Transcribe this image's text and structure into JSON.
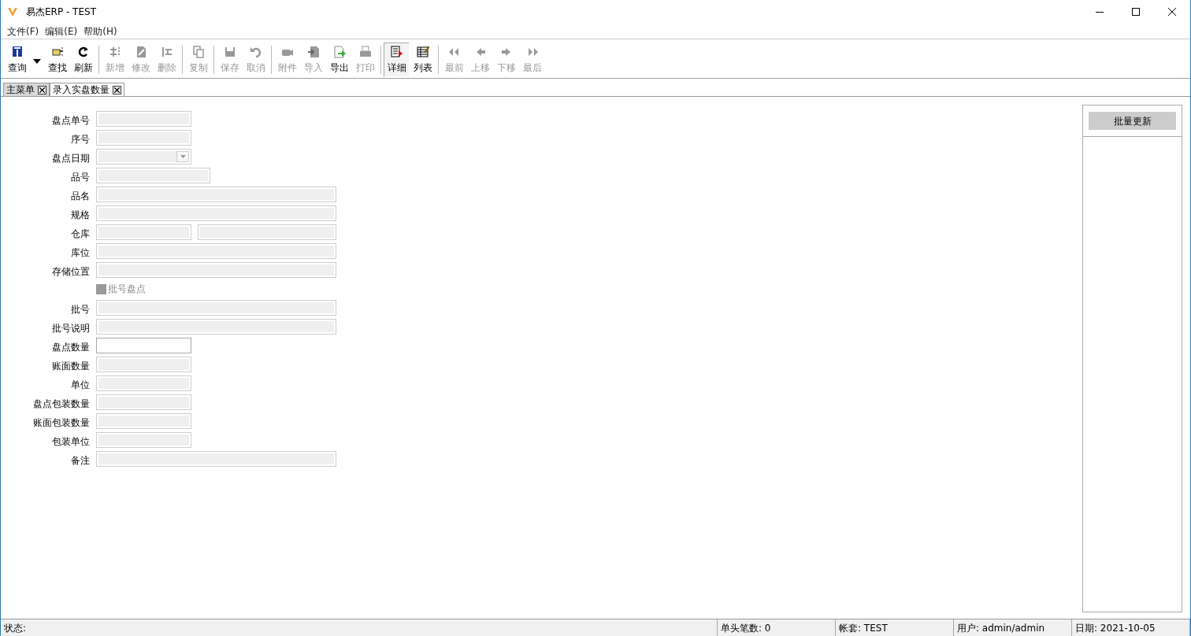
{
  "window": {
    "title": "易杰ERP - TEST"
  },
  "menu": [
    {
      "label": "文件(F)"
    },
    {
      "label": "编辑(E)"
    },
    {
      "label": "帮助(H)"
    }
  ],
  "toolbar": [
    {
      "kind": "button",
      "label": "查询",
      "disabled": false,
      "selected": false,
      "dropdown": true
    },
    {
      "kind": "button",
      "label": "查找",
      "disabled": false,
      "selected": false
    },
    {
      "kind": "button",
      "label": "刷新",
      "disabled": false,
      "selected": false
    },
    {
      "kind": "separator"
    },
    {
      "kind": "button",
      "label": "新增",
      "disabled": true,
      "selected": false
    },
    {
      "kind": "button",
      "label": "修改",
      "disabled": true,
      "selected": false
    },
    {
      "kind": "button",
      "label": "删除",
      "disabled": true,
      "selected": false
    },
    {
      "kind": "separator"
    },
    {
      "kind": "button",
      "label": "复制",
      "disabled": true,
      "selected": false
    },
    {
      "kind": "separator"
    },
    {
      "kind": "button",
      "label": "保存",
      "disabled": true,
      "selected": false
    },
    {
      "kind": "button",
      "label": "取消",
      "disabled": true,
      "selected": false
    },
    {
      "kind": "separator"
    },
    {
      "kind": "button",
      "label": "附件",
      "disabled": true,
      "selected": false
    },
    {
      "kind": "button",
      "label": "导入",
      "disabled": true,
      "selected": false
    },
    {
      "kind": "button",
      "label": "导出",
      "disabled": false,
      "selected": false
    },
    {
      "kind": "button",
      "label": "打印",
      "disabled": true,
      "selected": false
    },
    {
      "kind": "separator"
    },
    {
      "kind": "button",
      "label": "详细",
      "disabled": false,
      "selected": true
    },
    {
      "kind": "button",
      "label": "列表",
      "disabled": false,
      "selected": false
    },
    {
      "kind": "separator"
    },
    {
      "kind": "button",
      "label": "最前",
      "disabled": true,
      "selected": false
    },
    {
      "kind": "button",
      "label": "上移",
      "disabled": true,
      "selected": false
    },
    {
      "kind": "button",
      "label": "下移",
      "disabled": true,
      "selected": false
    },
    {
      "kind": "button",
      "label": "最后",
      "disabled": true,
      "selected": false
    }
  ],
  "tabs": [
    {
      "label": "主菜单",
      "selected": false
    },
    {
      "label": "录入实盘数量",
      "selected": true
    }
  ],
  "form": [
    {
      "kind": "short",
      "label": "盘点单号",
      "editable": false
    },
    {
      "kind": "short",
      "label": "序号",
      "editable": false
    },
    {
      "kind": "date",
      "label": "盘点日期",
      "editable": false
    },
    {
      "kind": "medium",
      "label": "品号",
      "editable": false
    },
    {
      "kind": "long",
      "label": "品名",
      "editable": false
    },
    {
      "kind": "long",
      "label": "规格",
      "editable": false
    },
    {
      "kind": "pair",
      "label": "仓库",
      "editable": false
    },
    {
      "kind": "long",
      "label": "库位",
      "editable": false
    },
    {
      "kind": "long",
      "label": "存储位置",
      "editable": false
    },
    {
      "kind": "checkbox",
      "label": "批号盘点",
      "checked": false,
      "disabled": true
    },
    {
      "kind": "long",
      "label": "批号",
      "editable": false
    },
    {
      "kind": "long",
      "label": "批号说明",
      "editable": false
    },
    {
      "kind": "short",
      "label": "盘点数量",
      "editable": true
    },
    {
      "kind": "short",
      "label": "账面数量",
      "editable": false
    },
    {
      "kind": "short",
      "label": "单位",
      "editable": false
    },
    {
      "kind": "short",
      "label": "盘点包装数量",
      "editable": false
    },
    {
      "kind": "short",
      "label": "账面包装数量",
      "editable": false
    },
    {
      "kind": "short",
      "label": "包装单位",
      "editable": false
    },
    {
      "kind": "long",
      "label": "备注",
      "editable": false
    }
  ],
  "side_panel": {
    "button": "批量更新"
  },
  "status_bar": [
    "状态:",
    "单头笔数: 0",
    "帐套: TEST",
    "用户: admin/admin",
    "日期: 2021-10-05"
  ]
}
